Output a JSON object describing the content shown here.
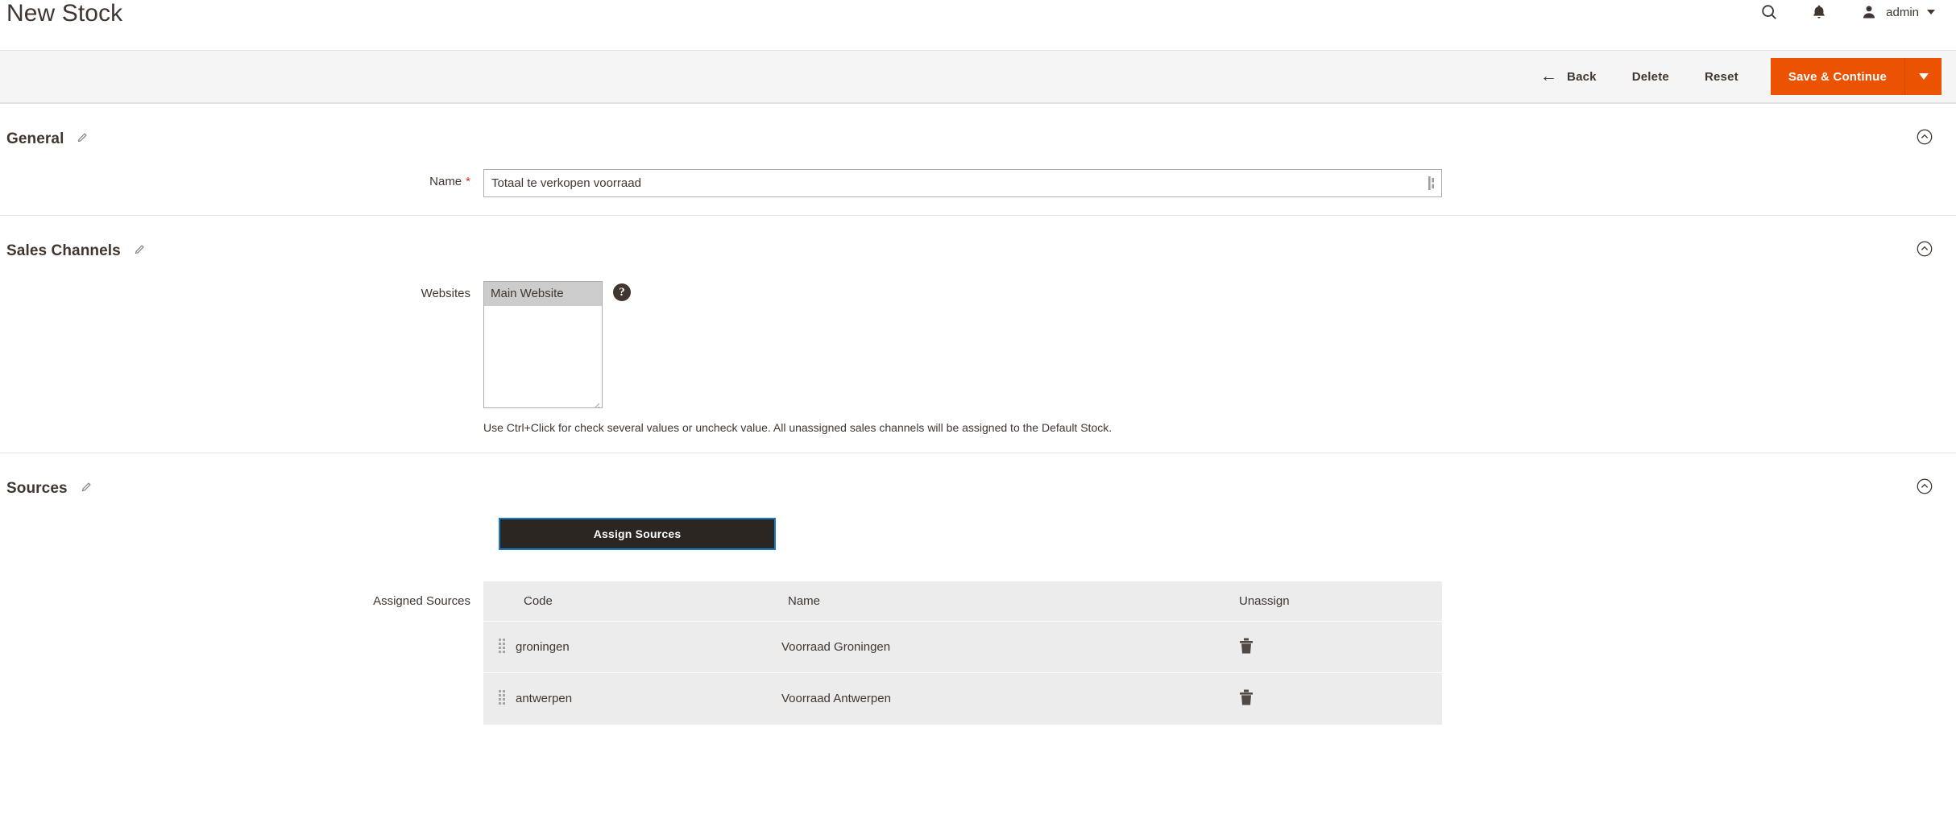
{
  "header": {
    "title": "New Stock",
    "search_icon": "search-icon",
    "notifications_icon": "bell-icon",
    "user_icon": "user-avatar-icon",
    "admin_label": "admin"
  },
  "toolbar": {
    "back_label": "Back",
    "back_arrow": "arrow-left-icon",
    "delete_label": "Delete",
    "reset_label": "Reset",
    "save_label": "Save & Continue",
    "save_toggle_icon": "caret-down-icon",
    "primary_color": "#eb5202"
  },
  "sections": {
    "general": {
      "title": "General",
      "edit_icon": "pencil-icon",
      "collapse_icon": "chevron-up-circle-icon",
      "name_label": "Name",
      "name_required": "*",
      "name_value": "Totaal te verkopen voorraad",
      "name_placeholder": ""
    },
    "sales_channels": {
      "title": "Sales Channels",
      "edit_icon": "pencil-icon",
      "collapse_icon": "chevron-up-circle-icon",
      "websites_label": "Websites",
      "websites_options": [
        "Main Website"
      ],
      "websites_selected": "Main Website",
      "tooltip_icon": "question-mark-icon",
      "note": "Use Ctrl+Click for check several values or uncheck value. All unassigned sales channels will be assigned to the Default Stock."
    },
    "sources": {
      "title": "Sources",
      "edit_icon": "pencil-icon",
      "collapse_icon": "chevron-up-circle-icon",
      "assign_button_label": "Assign Sources",
      "assigned_sources_label": "Assigned Sources",
      "columns": [
        "Code",
        "Name",
        "Unassign"
      ],
      "rows": [
        {
          "handle_icon": "drag-handle-icon",
          "code": "groningen",
          "name": "Voorraad Groningen",
          "unassign_icon": "trash-icon"
        },
        {
          "handle_icon": "drag-handle-icon",
          "code": "antwerpen",
          "name": "Voorraad Antwerpen",
          "unassign_icon": "trash-icon"
        }
      ]
    }
  }
}
